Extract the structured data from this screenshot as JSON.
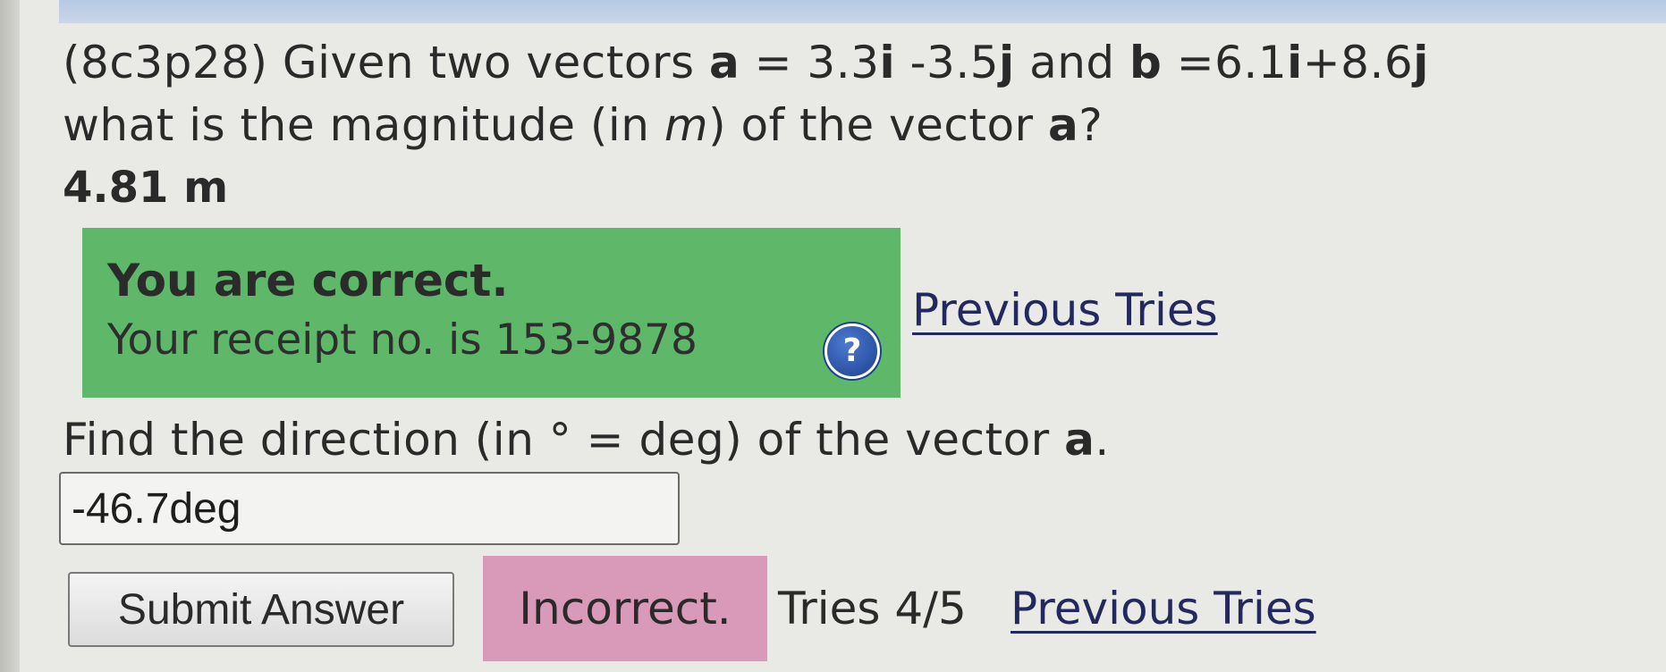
{
  "question": {
    "id_prefix": "(8c3p28) Given two vectors ",
    "a_symbol": "a",
    "a_eq": " = 3.3",
    "a_i": "i",
    "a_mid": " -3.5",
    "a_j": "j",
    "and": " and ",
    "b_symbol": "b",
    "b_eq": " =6.1",
    "b_i": "i",
    "b_mid": "+8.6",
    "b_j": "j",
    "line2_pre": "what is the magnitude (in ",
    "unit_var": "m",
    "line2_mid": ") of the vector ",
    "line2_vec": "a",
    "line2_post": "?"
  },
  "first_answer": {
    "value": "4.81 m"
  },
  "feedback": {
    "title": "You are correct.",
    "receipt_text": "Your receipt no. is 153-9878",
    "help_glyph": "?",
    "previous_tries_label": "Previous Tries"
  },
  "question2": {
    "pre": "Find the direction (in ° = deg) of the vector ",
    "vec": "a",
    "post": "."
  },
  "input": {
    "value": "-46.7deg"
  },
  "actions": {
    "submit_label": "Submit Answer",
    "result_label": "Incorrect.",
    "tries_label": "Tries 4/5",
    "previous_tries_label": "Previous Tries"
  },
  "colors": {
    "correct_bg": "#5fb76a",
    "incorrect_bg": "#d89ab8",
    "link": "#23285e",
    "help_icon": "#1e3f8f"
  },
  "icons": {
    "help": "help-question-icon"
  }
}
